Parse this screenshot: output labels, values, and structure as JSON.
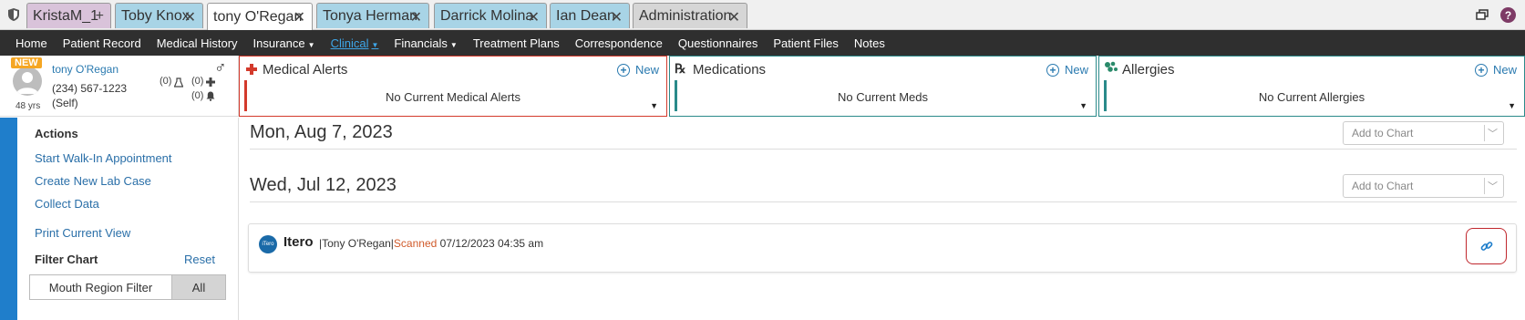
{
  "tabs": [
    {
      "label": "KristaM_1",
      "close": "+"
    },
    {
      "label": "Toby Knox",
      "close": "✕"
    },
    {
      "label": "tony O'Regan",
      "close": "✕"
    },
    {
      "label": "Tonya Herman",
      "close": "✕"
    },
    {
      "label": "Darrick Molina",
      "close": "✕"
    },
    {
      "label": "Ian Dean",
      "close": "✕"
    },
    {
      "label": "Administration",
      "close": "✕"
    }
  ],
  "nav": {
    "home": "Home",
    "patient_record": "Patient Record",
    "medical_history": "Medical History",
    "insurance": "Insurance",
    "clinical": "Clinical",
    "financials": "Financials",
    "treatment_plans": "Treatment Plans",
    "correspondence": "Correspondence",
    "questionnaires": "Questionnaires",
    "patient_files": "Patient Files",
    "notes": "Notes"
  },
  "patient": {
    "badge": "NEW",
    "name": "tony O'Regan",
    "phone": "(234) 567-1223",
    "relation": "(Self)",
    "age": "48 yrs",
    "gender_symbol": "♂",
    "lab_count": "(0)",
    "med_count": "(0)",
    "alert_count": "(0)"
  },
  "panels": {
    "medical_alerts": {
      "title": "Medical Alerts",
      "new": "New",
      "body": "No Current Medical Alerts",
      "accent": "#d33a2c"
    },
    "medications": {
      "title": "Medications",
      "new": "New",
      "body": "No Current Meds",
      "accent": "#2a8a8a"
    },
    "allergies": {
      "title": "Allergies",
      "new": "New",
      "body": "No Current Allergies",
      "accent": "#2a8a8a"
    }
  },
  "sidebar": {
    "actions_heading": "Actions",
    "start_walkin": "Start Walk-In Appointment",
    "create_lab": "Create New Lab Case",
    "collect_data": "Collect Data",
    "print_view": "Print Current View",
    "filter_heading": "Filter Chart",
    "reset": "Reset",
    "mouth_filter": "Mouth Region Filter",
    "all": "All"
  },
  "main": {
    "date1": "Mon, Aug 7, 2023",
    "date2": "Wed, Jul 12, 2023",
    "add_chart_placeholder": "Add to Chart",
    "itero": {
      "logo_text": "iTero",
      "title": "Itero",
      "patient": "Tony O'Regan",
      "status": "Scanned",
      "datetime": "07/12/2023 04:35 am"
    }
  },
  "colors": {
    "nav_bg": "#2f2f2f",
    "accent_blue": "#1f7ecb",
    "link": "#2a6fa8",
    "alert_red": "#d33a2c"
  }
}
